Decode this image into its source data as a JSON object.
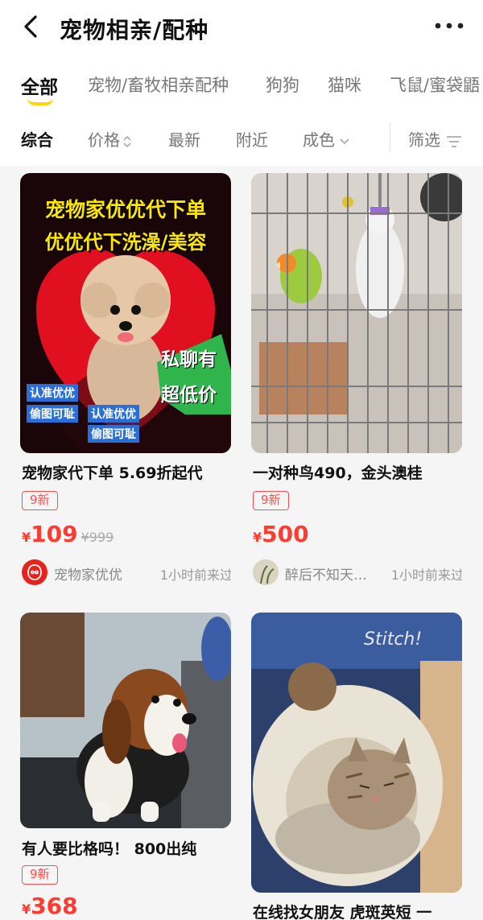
{
  "header": {
    "title": "宠物相亲/配种",
    "back_icon": "chevron-left-icon",
    "more_icon": "more-dots-icon"
  },
  "tabs": [
    {
      "label": "全部",
      "active": true
    },
    {
      "label": "宠物/畜牧相亲配种"
    },
    {
      "label": "狗狗"
    },
    {
      "label": "猫咪"
    },
    {
      "label": "飞鼠/蜜袋鼯"
    }
  ],
  "filters": {
    "comprehensive": "综合",
    "price": "价格",
    "newest": "最新",
    "nearby": "附近",
    "condition": "成色",
    "screen": "筛选"
  },
  "items": [
    {
      "title": "宠物家代下单 5.69折起代",
      "condition": "9新",
      "currency": "¥",
      "price": "109",
      "original_price": "¥999",
      "seller": "宠物家优优",
      "time": "1小时前来过",
      "img_text": {
        "line1": "宠物家优优代下单",
        "line2": "优优代下洗澡/美容",
        "badge_a": "私聊有",
        "badge_b": "超低价",
        "wm1a": "认准优优",
        "wm1b": "偷图可耻",
        "wm2a": "认准优优",
        "wm2b": "偷图可耻"
      }
    },
    {
      "title": "一对种鸟490，金头澳桂",
      "condition": "9新",
      "currency": "¥",
      "price": "500",
      "seller": "醉后不知天…",
      "time": "1小时前来过"
    },
    {
      "title": "有人要比格吗！ 800出纯",
      "condition": "9新",
      "currency": "¥",
      "price": "368"
    },
    {
      "title": "在线找女朋友 虎斑英短 一"
    }
  ],
  "colors": {
    "accent_yellow": "#ffd400",
    "price_red": "#ff3b30",
    "tag_red": "#ff4d4f"
  }
}
